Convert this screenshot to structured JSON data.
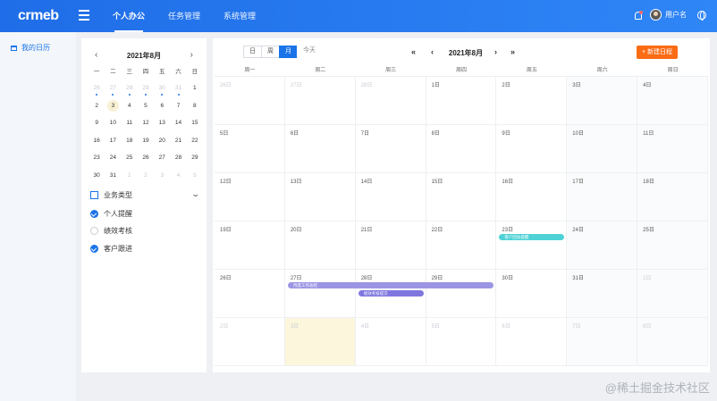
{
  "app": {
    "logo": "crmeb"
  },
  "nav": [
    {
      "label": "个人办公",
      "active": true
    },
    {
      "label": "任务管理",
      "active": false
    },
    {
      "label": "系统管理",
      "active": false
    }
  ],
  "user": {
    "name": "用户名"
  },
  "sidebar": {
    "items": [
      {
        "label": "我的日历",
        "active": true
      }
    ]
  },
  "mini_calendar": {
    "title": "2021年8月",
    "prev": "‹",
    "next": "›",
    "weekdays": [
      "一",
      "二",
      "三",
      "四",
      "五",
      "六",
      "日"
    ],
    "weeks": [
      [
        {
          "d": "26",
          "other": true,
          "dot": true
        },
        {
          "d": "27",
          "other": true,
          "dot": true
        },
        {
          "d": "28",
          "other": true,
          "dot": true
        },
        {
          "d": "29",
          "other": true,
          "dot": true
        },
        {
          "d": "30",
          "other": true,
          "dot": true
        },
        {
          "d": "31",
          "other": true,
          "dot": true
        },
        {
          "d": "1"
        }
      ],
      [
        {
          "d": "2"
        },
        {
          "d": "3",
          "today": true
        },
        {
          "d": "4"
        },
        {
          "d": "5"
        },
        {
          "d": "6"
        },
        {
          "d": "7"
        },
        {
          "d": "8"
        }
      ],
      [
        {
          "d": "9"
        },
        {
          "d": "10"
        },
        {
          "d": "11"
        },
        {
          "d": "12"
        },
        {
          "d": "13"
        },
        {
          "d": "14"
        },
        {
          "d": "15"
        }
      ],
      [
        {
          "d": "16"
        },
        {
          "d": "17"
        },
        {
          "d": "18"
        },
        {
          "d": "19"
        },
        {
          "d": "20"
        },
        {
          "d": "21"
        },
        {
          "d": "22"
        }
      ],
      [
        {
          "d": "23"
        },
        {
          "d": "24"
        },
        {
          "d": "25"
        },
        {
          "d": "26"
        },
        {
          "d": "27"
        },
        {
          "d": "28"
        },
        {
          "d": "29"
        }
      ],
      [
        {
          "d": "30"
        },
        {
          "d": "31"
        },
        {
          "d": "1",
          "other": true
        },
        {
          "d": "2",
          "other": true
        },
        {
          "d": "3",
          "other": true
        },
        {
          "d": "4",
          "other": true
        },
        {
          "d": "5",
          "other": true
        }
      ]
    ]
  },
  "filters": {
    "group_label": "业务类型",
    "items": [
      {
        "label": "个人提醒",
        "checked": true
      },
      {
        "label": "绩效考核",
        "checked": false
      },
      {
        "label": "客户跟进",
        "checked": true
      }
    ]
  },
  "toolbar": {
    "view_day": "日",
    "view_week": "周",
    "view_month": "月",
    "view_today": "今天",
    "active_view": "月",
    "title": "2021年8月",
    "prev_year": "«",
    "prev_month": "‹",
    "next_month": "›",
    "next_year": "»",
    "new_button": "+ 新建日程"
  },
  "calendar": {
    "weekdays": [
      "周一",
      "周二",
      "周三",
      "周四",
      "周五",
      "周六",
      "周日"
    ],
    "weeks": [
      [
        {
          "d": "26日",
          "other": true
        },
        {
          "d": "27日",
          "other": true
        },
        {
          "d": "28日",
          "other": true
        },
        {
          "d": "1日"
        },
        {
          "d": "2日"
        },
        {
          "d": "3日"
        },
        {
          "d": "4日"
        }
      ],
      [
        {
          "d": "5日"
        },
        {
          "d": "6日"
        },
        {
          "d": "7日"
        },
        {
          "d": "8日"
        },
        {
          "d": "9日"
        },
        {
          "d": "10日"
        },
        {
          "d": "11日"
        }
      ],
      [
        {
          "d": "12日"
        },
        {
          "d": "13日"
        },
        {
          "d": "14日"
        },
        {
          "d": "15日"
        },
        {
          "d": "16日"
        },
        {
          "d": "17日"
        },
        {
          "d": "18日"
        }
      ],
      [
        {
          "d": "19日"
        },
        {
          "d": "20日"
        },
        {
          "d": "21日"
        },
        {
          "d": "22日"
        },
        {
          "d": "23日"
        },
        {
          "d": "24日"
        },
        {
          "d": "25日"
        }
      ],
      [
        {
          "d": "26日"
        },
        {
          "d": "27日"
        },
        {
          "d": "28日"
        },
        {
          "d": "29日"
        },
        {
          "d": "30日"
        },
        {
          "d": "31日"
        },
        {
          "d": "1日",
          "other": true
        }
      ],
      [
        {
          "d": "2日",
          "other": true
        },
        {
          "d": "3日",
          "other": true,
          "today": true
        },
        {
          "d": "4日",
          "other": true
        },
        {
          "d": "5日",
          "other": true
        },
        {
          "d": "6日",
          "other": true
        },
        {
          "d": "7日",
          "other": true
        },
        {
          "d": "8日",
          "other": true
        }
      ]
    ],
    "events": [
      {
        "title": "客户回访提醒",
        "week": 3,
        "start": 4,
        "end": 4,
        "color": "#4fd2d6"
      },
      {
        "title": "月度工作总结",
        "week": 4,
        "start": 1,
        "end": 3,
        "color": "#9b95e4"
      },
      {
        "title": "绩效考核提交",
        "week": 4,
        "start": 2,
        "end": 2,
        "color": "#7f77df",
        "lane": 1
      }
    ]
  },
  "watermark": "@稀土掘金技术社区"
}
